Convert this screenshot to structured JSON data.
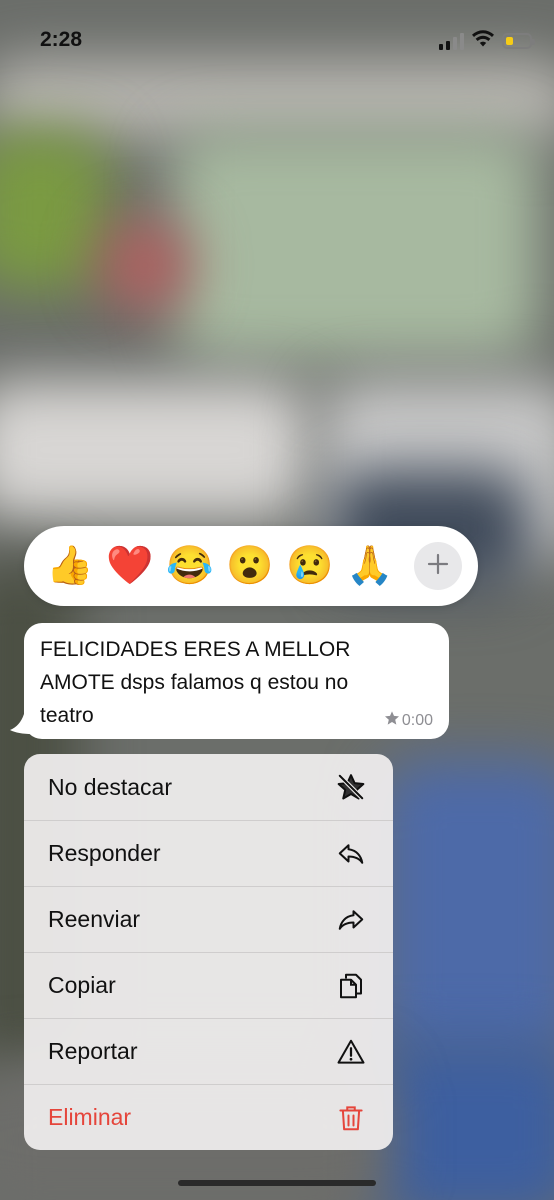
{
  "status_bar": {
    "time": "2:28",
    "battery_level": 0.3,
    "battery_color": "#f6cc16"
  },
  "reactions": {
    "items": [
      {
        "emoji": "👍",
        "name": "thumbs-up"
      },
      {
        "emoji": "❤️",
        "name": "heart"
      },
      {
        "emoji": "😂",
        "name": "tears-of-joy"
      },
      {
        "emoji": "😮",
        "name": "surprised"
      },
      {
        "emoji": "😢",
        "name": "crying"
      },
      {
        "emoji": "🙏",
        "name": "praying-hands"
      }
    ],
    "more_icon": "plus-icon"
  },
  "message": {
    "text": "FELICIDADES ERES A MELLOR\nAMOTE dsps falamos q estou no\nteatro",
    "time": "0:00",
    "starred_icon": "star-icon"
  },
  "menu": {
    "items": [
      {
        "label": "No destacar",
        "icon": "unstar-icon"
      },
      {
        "label": "Responder",
        "icon": "reply-icon"
      },
      {
        "label": "Reenviar",
        "icon": "forward-icon"
      },
      {
        "label": "Copiar",
        "icon": "copy-icon"
      },
      {
        "label": "Reportar",
        "icon": "warning-icon"
      },
      {
        "label": "Eliminar",
        "icon": "trash-icon"
      }
    ],
    "danger_color": "#e5453b"
  }
}
